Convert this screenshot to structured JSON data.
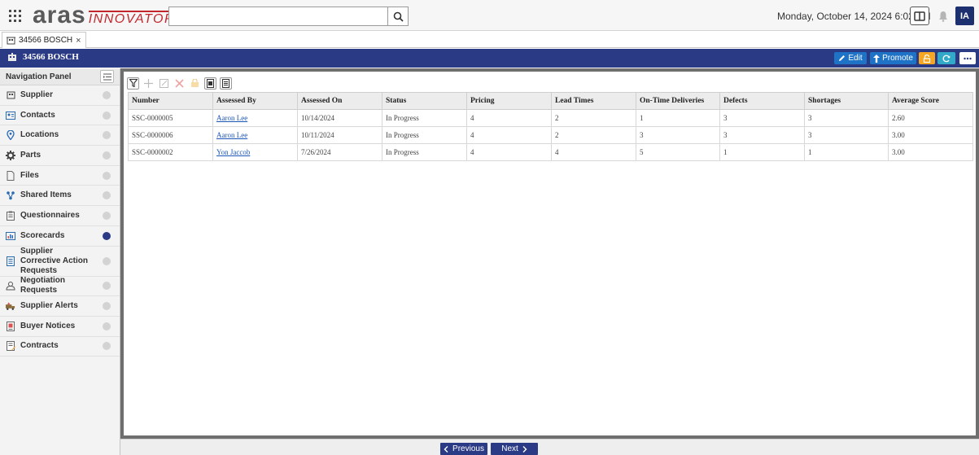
{
  "header": {
    "logo_main": "aras",
    "logo_sub": "INNOVATOR",
    "search_value": "",
    "datetime": "Monday, October 14, 2024 6:02 AM",
    "user_initials": "IA"
  },
  "tabs": [
    {
      "label": "34566 BOSCH",
      "close": "×"
    }
  ],
  "titlebar": {
    "title": "34566 BOSCH",
    "edit_label": "Edit",
    "promote_label": "Promote"
  },
  "nav": {
    "header": "Navigation Panel",
    "items": [
      {
        "label": "Supplier",
        "icon": "building-icon",
        "active": false
      },
      {
        "label": "Contacts",
        "icon": "contact-card-icon",
        "active": false
      },
      {
        "label": "Locations",
        "icon": "location-pin-icon",
        "active": false
      },
      {
        "label": "Parts",
        "icon": "gear-icon",
        "active": false
      },
      {
        "label": "Files",
        "icon": "file-icon",
        "active": false
      },
      {
        "label": "Shared Items",
        "icon": "share-icon",
        "active": false
      },
      {
        "label": "Questionnaires",
        "icon": "clipboard-icon",
        "active": false
      },
      {
        "label": "Scorecards",
        "icon": "scorecard-icon",
        "active": true
      },
      {
        "label": "Supplier Corrective Action Requests",
        "icon": "document-icon",
        "active": false
      },
      {
        "label": "Negotiation Requests",
        "icon": "handshake-icon",
        "active": false
      },
      {
        "label": "Supplier Alerts",
        "icon": "alert-truck-icon",
        "active": false
      },
      {
        "label": "Buyer Notices",
        "icon": "notice-icon",
        "active": false
      },
      {
        "label": "Contracts",
        "icon": "contract-icon",
        "active": false
      }
    ]
  },
  "grid": {
    "columns": [
      "Number",
      "Assessed By",
      "Assessed On",
      "Status",
      "Pricing",
      "Lead Times",
      "On-Time Deliveries",
      "Defects",
      "Shortages",
      "Average Score"
    ],
    "rows": [
      [
        "SSC-0000005",
        "Aaron Lee",
        "10/14/2024",
        "In Progress",
        "4",
        "2",
        "1",
        "3",
        "3",
        "2.60"
      ],
      [
        "SSC-0000006",
        "Aaron Lee",
        "10/11/2024",
        "In Progress",
        "4",
        "2",
        "3",
        "3",
        "3",
        "3.00"
      ],
      [
        "SSC-0000002",
        "Yon Jaccob",
        "7/26/2024",
        "In Progress",
        "4",
        "4",
        "5",
        "1",
        "1",
        "3.00"
      ]
    ]
  },
  "pager": {
    "previous_label": "Previous",
    "next_label": "Next"
  },
  "colors": {
    "brand_navy": "#2b3a85",
    "button_blue": "#1f73c7",
    "logo_red": "#c1272d",
    "lock_orange": "#f5a623",
    "refresh_teal": "#33a9c9"
  }
}
